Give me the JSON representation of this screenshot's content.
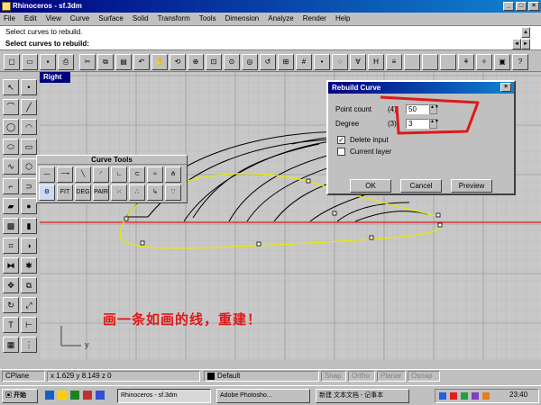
{
  "window": {
    "title": "Rhinoceros - sf.3dm",
    "min_label": "_",
    "max_label": "□",
    "close_label": "×"
  },
  "menu": [
    "File",
    "Edit",
    "View",
    "Curve",
    "Surface",
    "Solid",
    "Transform",
    "Tools",
    "Dimension",
    "Analyze",
    "Render",
    "Help"
  ],
  "command": {
    "line1": "Select curves to rebuild.",
    "line2": "Select curves to rebuild:"
  },
  "viewport": {
    "name": "Right"
  },
  "curve_tools": {
    "title": "Curve Tools",
    "buttons": [
      "FIT",
      "DEG",
      "PAIR"
    ]
  },
  "dialog": {
    "title": "Rebuild Curve",
    "point_label": "Point count",
    "point_value": "50",
    "degree_label": "Degree",
    "degree_value": "3",
    "delete_input_label": "Delete input",
    "delete_input_checked": true,
    "current_layer_label": "Current layer",
    "current_layer_checked": false,
    "ok_label": "OK",
    "cancel_label": "Cancel",
    "preview_label": "Preview",
    "hint_left": "(4)",
    "hint_right": "(3)"
  },
  "annotation": "画一条如画的线，重建！",
  "axis": {
    "y": "y"
  },
  "status": {
    "cplane": "CPlane",
    "coords": "x 1.629 y 8.149 z 0",
    "layer": "Default",
    "snap": "Snap",
    "ortho": "Ortho",
    "planar": "Planar",
    "osnap": "Osnap"
  },
  "taskbar": {
    "items": [
      "Rhinoceros - sf.3dm",
      "Adobe Photosho...",
      "新建 文本文档 - 记事本"
    ],
    "clock": "23:40"
  },
  "colors": {
    "title_blue": "#000080",
    "annotation_red": "#e01818",
    "curve_yellow": "#e8e800",
    "axis_red": "#e01818"
  }
}
